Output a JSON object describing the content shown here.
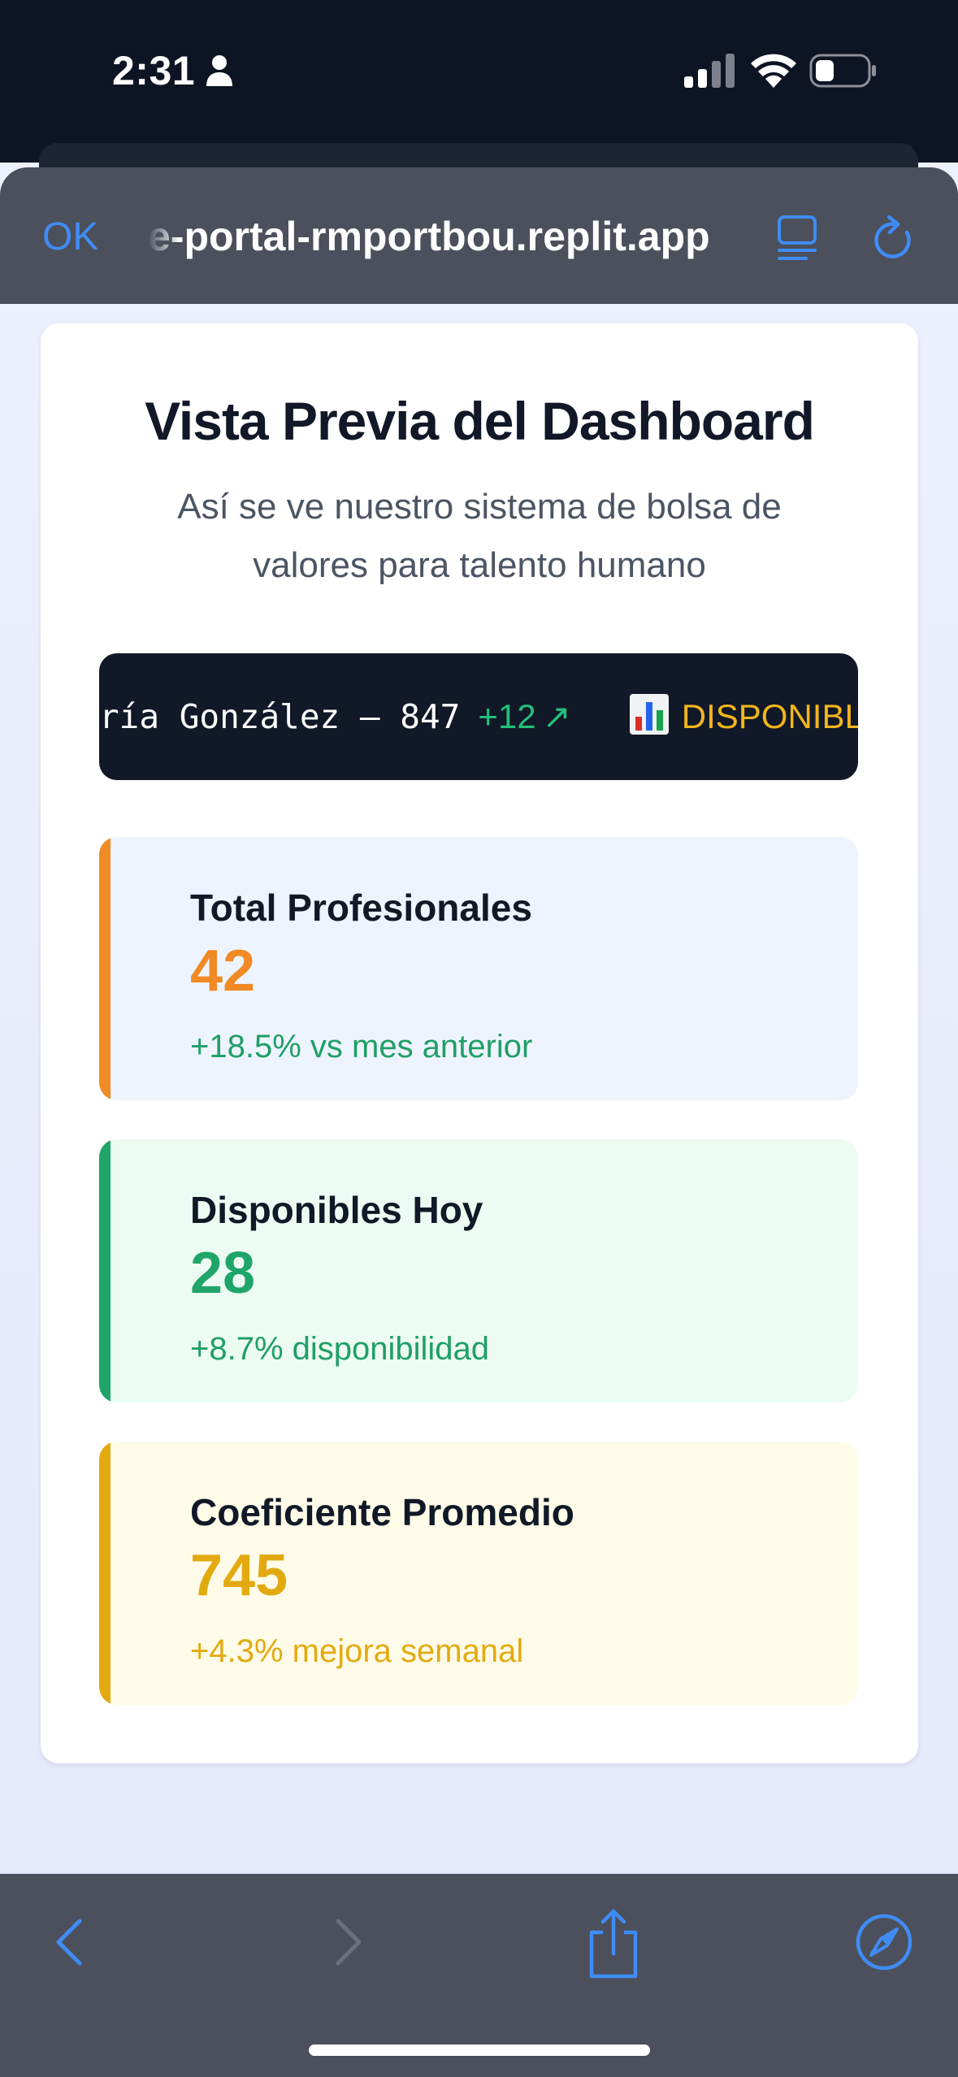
{
  "status_bar": {
    "time": "2:31"
  },
  "browser": {
    "done_label": "OK",
    "url": "e-portal-rmportbou.replit.app"
  },
  "page": {
    "title": "Vista Previa del Dashboard",
    "subtitle": "Así se ve nuestro sistema de bolsa de valores para talento humano"
  },
  "ticker": {
    "name": "ría González – 847",
    "change": "+12",
    "arrow": "↗",
    "status": "DISPONIBLE"
  },
  "stats": [
    {
      "label": "Total Profesionales",
      "value": "42",
      "delta": "+18.5% vs mes anterior",
      "accent": "#f08a24"
    },
    {
      "label": "Disponibles Hoy",
      "value": "28",
      "delta": "+8.7% disponibilidad",
      "accent": "#1fa56a"
    },
    {
      "label": "Coeficiente Promedio",
      "value": "745",
      "delta": "+4.3% mejora semanal",
      "accent": "#e3aa10"
    }
  ],
  "colors": {
    "link_blue": "#3f8cf5",
    "ticker_bg": "#111827",
    "chrome_bg": "#4b505c"
  },
  "icons": [
    "person-icon",
    "signal-icon",
    "wifi-icon",
    "battery-icon",
    "reader-icon",
    "reload-icon",
    "chart-icon",
    "back-icon",
    "forward-icon",
    "share-icon",
    "compass-icon"
  ]
}
